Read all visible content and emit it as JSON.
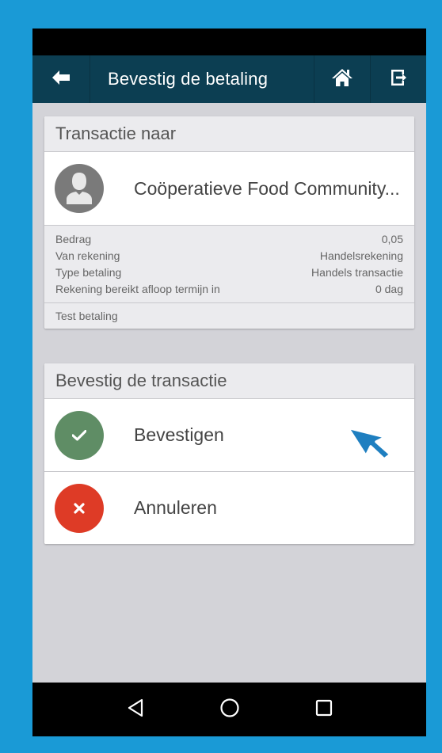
{
  "app_bar": {
    "title": "Bevestig de betaling",
    "back_icon": "arrow-left-icon",
    "home_icon": "home-icon",
    "logout_icon": "logout-icon",
    "background_color": "#0c3e52"
  },
  "transaction_card": {
    "header": "Transactie naar",
    "recipient": "Coöperatieve Food Community...",
    "details": [
      {
        "label": "Bedrag",
        "value": "0,05"
      },
      {
        "label": "Van rekening",
        "value": "Handelsrekening"
      },
      {
        "label": "Type betaling",
        "value": "Handels transactie"
      },
      {
        "label": "Rekening bereikt afloop termijn in",
        "value": "0 dag"
      }
    ],
    "note": "Test betaling"
  },
  "confirm_card": {
    "header": "Bevestig de transactie",
    "confirm_label": "Bevestigen",
    "cancel_label": "Annuleren",
    "confirm_color": "#5f8d65",
    "cancel_color": "#de3b26"
  },
  "nav_bar": {
    "back_icon": "triangle-back-icon",
    "home_icon": "circle-home-icon",
    "recents_icon": "square-recents-icon"
  }
}
